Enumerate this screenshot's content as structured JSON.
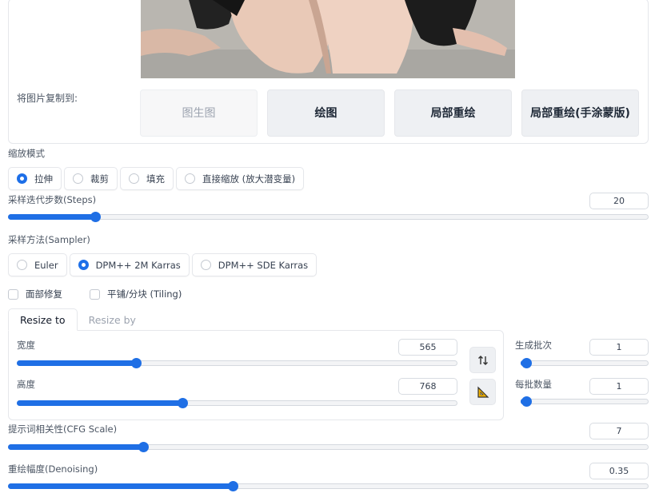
{
  "copy_to": {
    "label": "将图片复制到:",
    "buttons": [
      "图生图",
      "绘图",
      "局部重绘",
      "局部重绘(手涂蒙版)"
    ]
  },
  "resize_mode": {
    "label": "缩放模式",
    "options": [
      "拉伸",
      "裁剪",
      "填充",
      "直接缩放 (放大潜变量)"
    ],
    "selected": "拉伸"
  },
  "steps": {
    "label": "采样迭代步数(Steps)",
    "value": "20",
    "fraction": 0.135
  },
  "sampler": {
    "label": "采样方法(Sampler)",
    "options": [
      "Euler",
      "DPM++ 2M Karras",
      "DPM++ SDE Karras"
    ],
    "selected": "DPM++ 2M Karras"
  },
  "checkboxes": {
    "face_restore": "面部修复",
    "tiling": "平铺/分块 (Tiling)"
  },
  "tabs": [
    "Resize to",
    "Resize by"
  ],
  "width": {
    "label": "宽度",
    "value": "565",
    "fraction": 0.27
  },
  "height": {
    "label": "高度",
    "value": "768",
    "fraction": 0.375
  },
  "batch_count": {
    "label": "生成批次",
    "value": "1",
    "fraction": 0.0
  },
  "batch_size": {
    "label": "每批数量",
    "value": "1",
    "fraction": 0.0
  },
  "cfg": {
    "label": "提示词相关性(CFG Scale)",
    "value": "7",
    "fraction": 0.21
  },
  "denoise": {
    "label": "重绘幅度(Denoising)",
    "value": "0.35",
    "fraction": 0.35
  },
  "icons": {
    "swap": "swap-dimensions-icon",
    "ratio": "triangle-ruler-icon"
  },
  "colors": {
    "accent": "#1f6fe5"
  }
}
